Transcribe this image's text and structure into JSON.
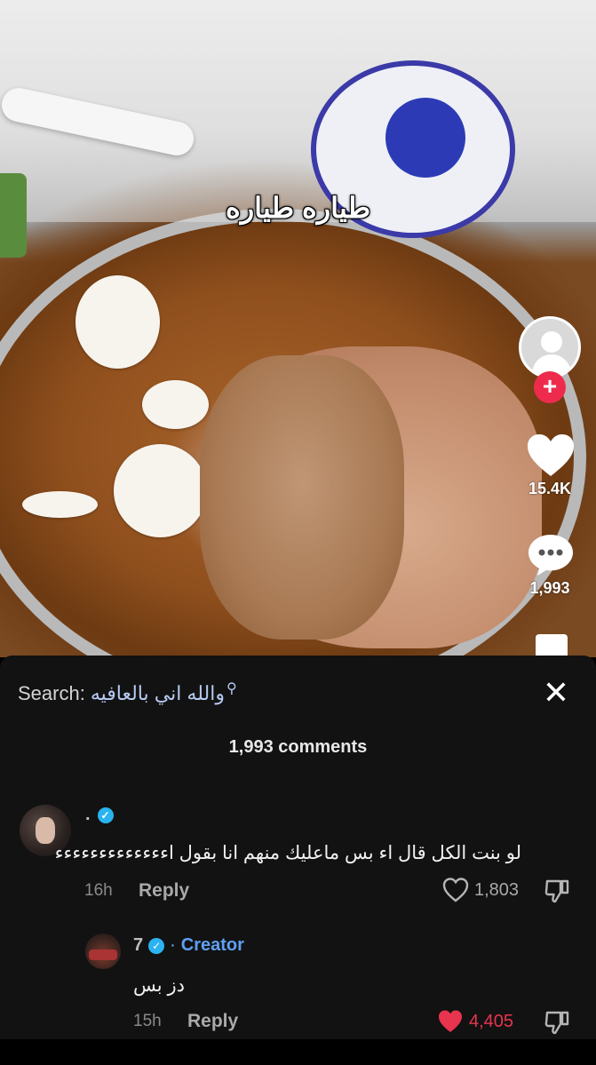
{
  "video": {
    "overlay_caption": "طياره طياره",
    "side_rail": {
      "likes_count": "15.4K",
      "comments_count": "1,993"
    },
    "icons": [
      "profile-avatar-icon",
      "follow-plus-icon",
      "heart-icon",
      "comment-bubble-icon",
      "bookmark-icon"
    ],
    "colors": {
      "follow_plus": "#EE2B4C"
    }
  },
  "comments_panel": {
    "search": {
      "label": "Search:",
      "query": "والله اني بالعافيه"
    },
    "title": "1,993 comments",
    "comments": [
      {
        "username": ".",
        "verified": true,
        "text": "لو بنت الكل قال اء بس ماعليك منهم انا بقول اءءءءءءءءءءءءء",
        "time": "16h",
        "reply_label": "Reply",
        "likes": "1,803",
        "liked": false
      }
    ],
    "replies": [
      {
        "username": "7",
        "verified": true,
        "separator": "·",
        "badge": "Creator",
        "text": "دز بس",
        "time": "15h",
        "reply_label": "Reply",
        "likes": "4,405",
        "liked": true
      }
    ],
    "colors": {
      "panel_bg": "#121212",
      "liked_heart": "#E8344E",
      "creator_badge": "#5FA0F2",
      "verified": "#2AB3F0"
    }
  }
}
